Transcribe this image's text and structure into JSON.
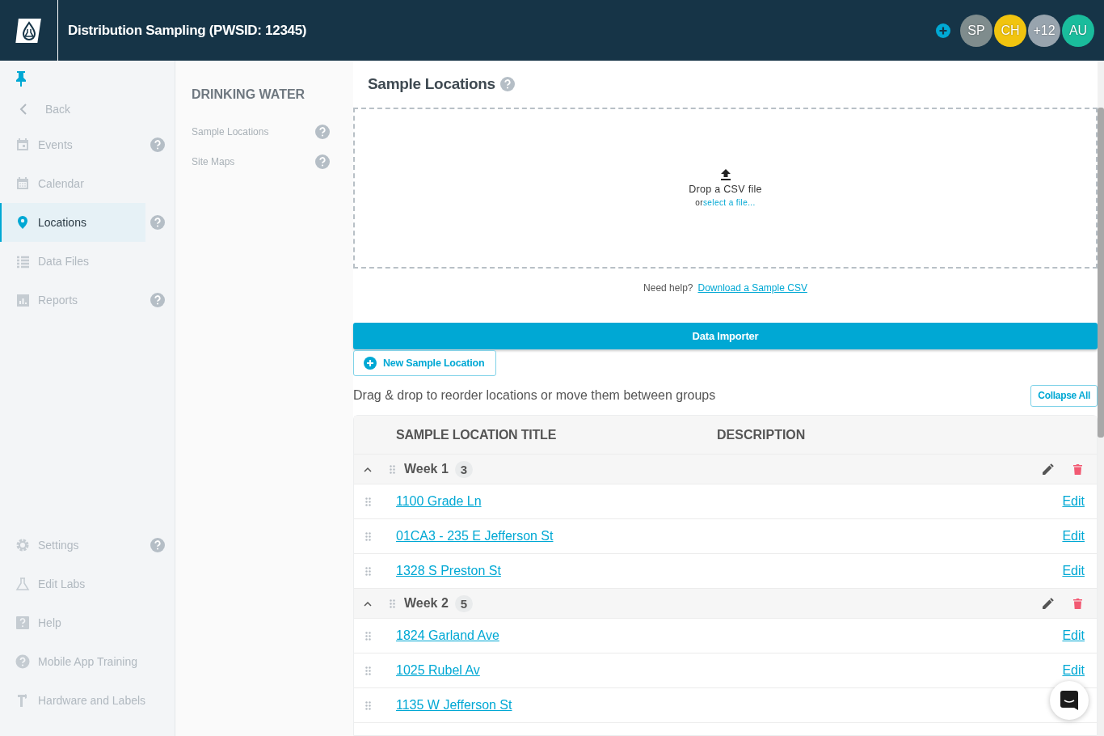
{
  "header": {
    "title": "Distribution Sampling (PWSID: 12345)",
    "avatars": [
      {
        "initials": "SP",
        "color": "#7f8c8d"
      },
      {
        "initials": "CH",
        "color": "#f1c40f"
      },
      {
        "initials": "+12",
        "color": "#98a4ae"
      },
      {
        "initials": "AU",
        "color": "#1abc9c"
      }
    ]
  },
  "sidebar": {
    "back": "Back",
    "items": [
      {
        "label": "Events",
        "help": true,
        "selected": false
      },
      {
        "label": "Calendar",
        "help": false,
        "selected": false
      },
      {
        "label": "Locations",
        "help": true,
        "selected": true
      },
      {
        "label": "Data Files",
        "help": false,
        "selected": false
      },
      {
        "label": "Reports",
        "help": true,
        "selected": false
      }
    ],
    "bottom_items": [
      {
        "label": "Settings",
        "help": true
      },
      {
        "label": "Edit Labs",
        "help": false
      },
      {
        "label": "Help",
        "help": false
      },
      {
        "label": "Mobile App Training",
        "help": false
      },
      {
        "label": "Hardware and Labels",
        "help": false
      }
    ]
  },
  "subnav": {
    "heading": "DRINKING WATER",
    "items": [
      {
        "label": "Sample Locations"
      },
      {
        "label": "Site Maps"
      }
    ]
  },
  "main": {
    "title": "Sample Locations",
    "dropzone": {
      "prompt": "Drop a CSV file",
      "or": "or",
      "link": "select a file..."
    },
    "help_text": "Need help?",
    "help_link": "Download a Sample CSV",
    "importer_button": "Data Importer",
    "new_button": "New Sample Location",
    "instructions": "Drag & drop to reorder locations or move them between groups",
    "collapse_button": "Collapse All",
    "table": {
      "columns": [
        "SAMPLE LOCATION TITLE",
        "DESCRIPTION"
      ],
      "groups": [
        {
          "name": "Week 1",
          "count": "3",
          "expanded": true,
          "rows": [
            {
              "title": "1100 Grade Ln",
              "action": "Edit"
            },
            {
              "title": "01CA3 - 235 E Jefferson St",
              "action": "Edit"
            },
            {
              "title": "1328 S Preston St",
              "action": "Edit"
            }
          ]
        },
        {
          "name": "Week 2",
          "count": "5",
          "expanded": true,
          "rows": [
            {
              "title": "1824 Garland Ave",
              "action": "Edit"
            },
            {
              "title": "1025 Rubel Av",
              "action": "Edit"
            },
            {
              "title": "1135 W Jefferson St"
            }
          ]
        }
      ]
    }
  }
}
